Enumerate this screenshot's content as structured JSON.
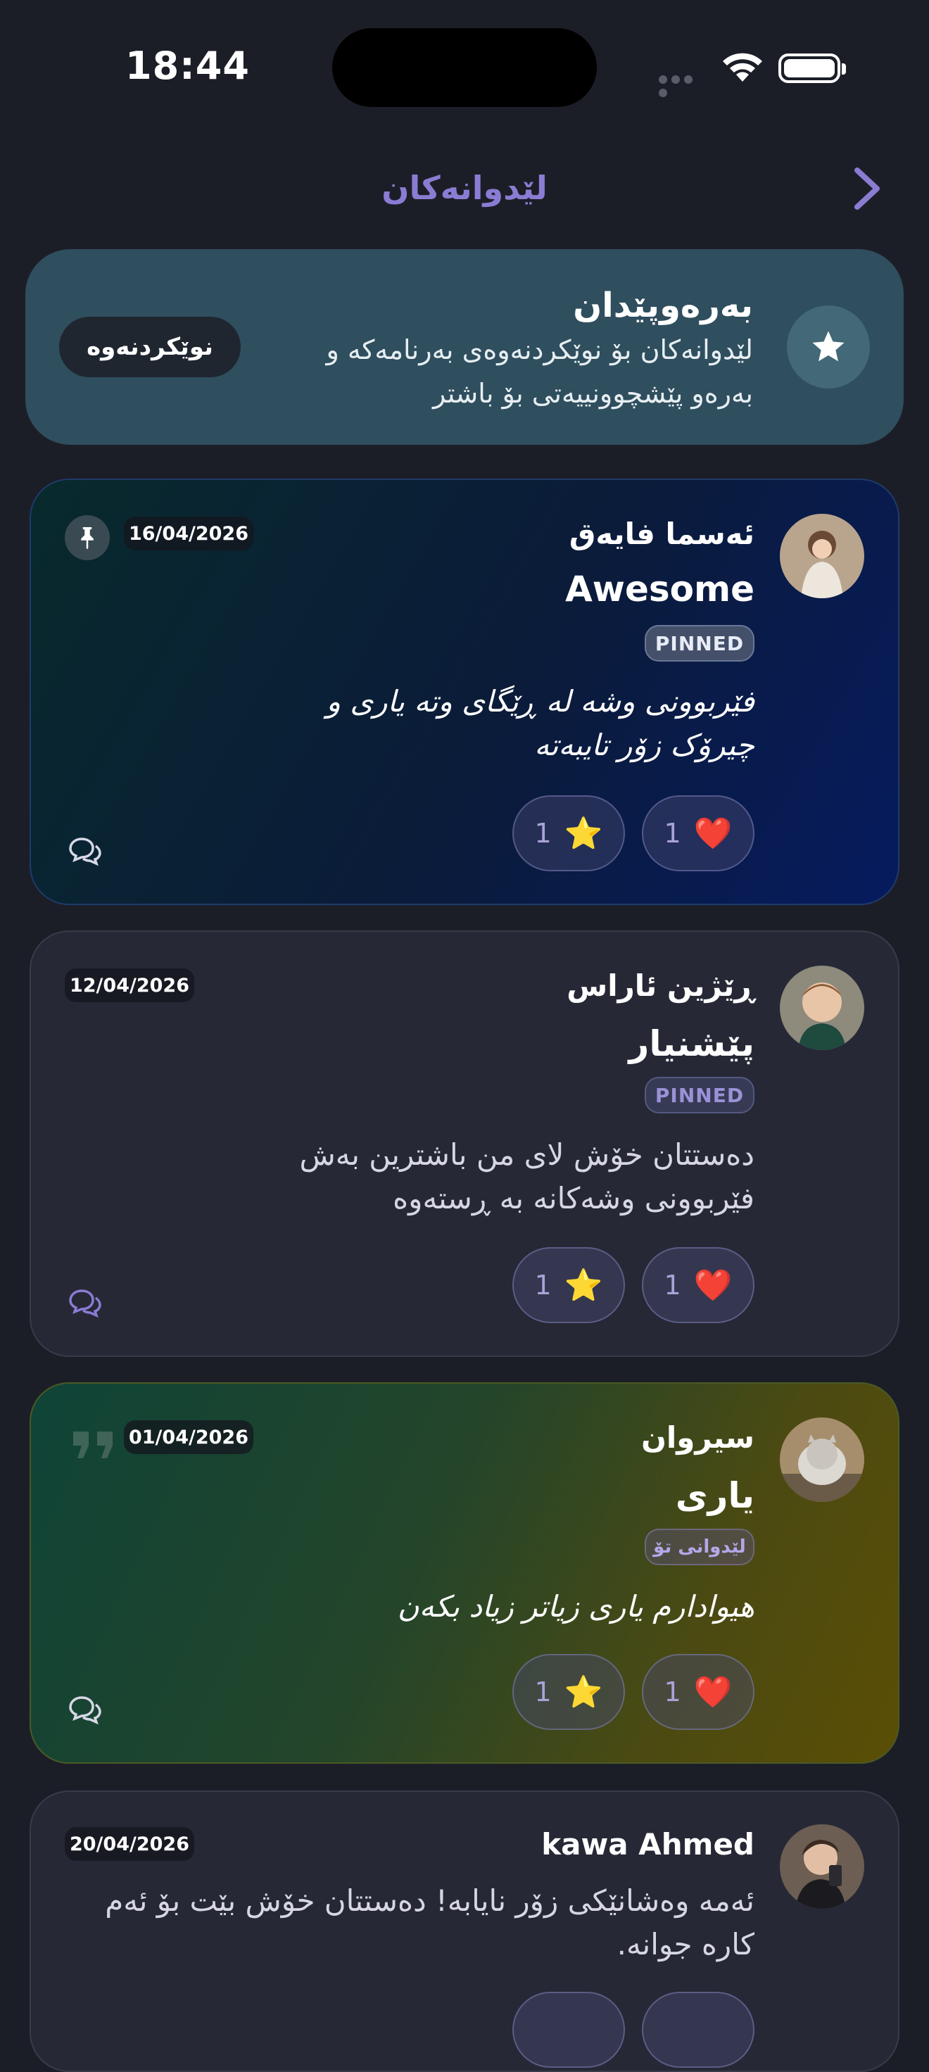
{
  "status_bar": {
    "time": "18:44"
  },
  "header": {
    "title": "لێدوانەکان"
  },
  "banner": {
    "title": "بەرەوپێدان",
    "subtitle": "لێدوانەکان بۆ نوێکردنەوەی بەرنامەکە و بەرەو پێشچوونییەتی بۆ باشتر",
    "button": "نوێکردنەوە"
  },
  "comments": [
    {
      "author": "ئەسما فایەق",
      "title": "Awesome",
      "badge": "PINNED",
      "body": "فێربوونی وشە لە ڕێگای وتە یاری و چیرۆک زۆر تایبەتە",
      "date": "16/04/2026",
      "reactions": [
        {
          "emoji": "❤️",
          "count": "1"
        },
        {
          "emoji": "⭐",
          "count": "1"
        }
      ]
    },
    {
      "author": "ڕێژین ئاراس",
      "title": "پێشنیار",
      "badge": "PINNED",
      "body": "دەستتان خۆش لای من باشترین بەش فێربوونی وشەکانە بە ڕستەوە",
      "date": "12/04/2026",
      "reactions": [
        {
          "emoji": "❤️",
          "count": "1"
        },
        {
          "emoji": "⭐",
          "count": "1"
        }
      ]
    },
    {
      "author": "سیروان",
      "title": "یاری",
      "badge": "لێدوانی تۆ",
      "body": "هیوادارم یاری زیاتر زیاد بکەن",
      "date": "01/04/2026",
      "reactions": [
        {
          "emoji": "❤️",
          "count": "1"
        },
        {
          "emoji": "⭐",
          "count": "1"
        }
      ]
    },
    {
      "author": "kawa Ahmed",
      "body": "ئەمە وەشانێکی زۆر نایابە! دەستتان خۆش بێت بۆ ئەم کارە جوانە.",
      "date": "20/04/2026"
    }
  ],
  "colors": {
    "accent": "#8a7cd3",
    "background": "#1c1e27",
    "banner": "#2f4e5e"
  }
}
